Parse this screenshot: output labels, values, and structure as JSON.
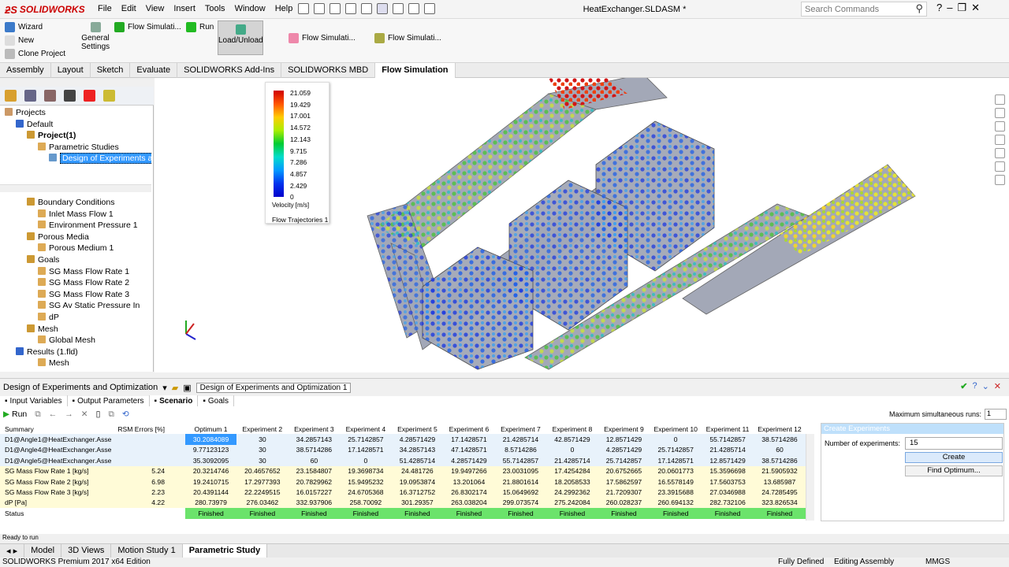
{
  "app": {
    "logo": "SOLIDWORKS",
    "doc_title": "HeatExchanger.SLDASM *",
    "search_placeholder": "Search Commands"
  },
  "menu": [
    "File",
    "Edit",
    "View",
    "Insert",
    "Tools",
    "Window",
    "Help"
  ],
  "ribbon": {
    "wizard": "Wizard",
    "new": "New",
    "clone": "Clone Project",
    "general": "General",
    "settings": "Settings",
    "flow1": "Flow Simulati...",
    "run": "Run",
    "load": "Load/Unload",
    "flow2": "Flow Simulati...",
    "flow3": "Flow Simulati..."
  },
  "tabs": [
    "Assembly",
    "Layout",
    "Sketch",
    "Evaluate",
    "SOLIDWORKS Add-Ins",
    "SOLIDWORKS MBD",
    "Flow Simulation"
  ],
  "tree_top": [
    {
      "label": "Projects",
      "indent": 0
    },
    {
      "label": "Default",
      "indent": 1
    },
    {
      "label": "Project(1)",
      "indent": 2,
      "bold": true
    },
    {
      "label": "Parametric Studies",
      "indent": 3
    },
    {
      "label": "Design of Experiments an",
      "indent": 4,
      "selected": true
    }
  ],
  "tree_bottom": [
    {
      "label": "Boundary Conditions",
      "indent": 2
    },
    {
      "label": "Inlet Mass Flow 1",
      "indent": 3
    },
    {
      "label": "Environment Pressure 1",
      "indent": 3
    },
    {
      "label": "Porous Media",
      "indent": 2
    },
    {
      "label": "Porous Medium 1",
      "indent": 3
    },
    {
      "label": "Goals",
      "indent": 2
    },
    {
      "label": "SG Mass Flow Rate 1",
      "indent": 3
    },
    {
      "label": "SG Mass Flow Rate 2",
      "indent": 3
    },
    {
      "label": "SG Mass Flow Rate 3",
      "indent": 3
    },
    {
      "label": "SG Av Static Pressure In",
      "indent": 3
    },
    {
      "label": "dP",
      "indent": 3
    },
    {
      "label": "Mesh",
      "indent": 2
    },
    {
      "label": "Global Mesh",
      "indent": 3
    },
    {
      "label": "Results (1.fld)",
      "indent": 1
    },
    {
      "label": "Mesh",
      "indent": 3
    }
  ],
  "legend": {
    "values": [
      "21.059",
      "19.429",
      "17.001",
      "14.572",
      "12.143",
      "9.715",
      "7.286",
      "4.857",
      "2.429",
      "0"
    ],
    "unit": "Velocity [m/s]",
    "name": "Flow Trajectories 1"
  },
  "bottom": {
    "study_name": "Design of Experiments and Optimization",
    "study_field": "Design of Experiments and Optimization 1",
    "subtabs": [
      "Input Variables",
      "Output Parameters",
      "Scenario",
      "Goals"
    ],
    "run": "Run",
    "max_label": "Maximum simultaneous runs:",
    "max_value": "1"
  },
  "table": {
    "columns": [
      "Summary",
      "RSM Errors [%]",
      "Optimum 1",
      "Experiment 2",
      "Experiment 3",
      "Experiment 4",
      "Experiment 5",
      "Experiment 6",
      "Experiment 7",
      "Experiment 8",
      "Experiment 9",
      "Experiment 10",
      "Experiment 11",
      "Experiment 12"
    ],
    "rows": [
      {
        "label": "D1@Angle1@HeatExchanger.Asse",
        "rsm": "",
        "cells": [
          "30.2084089",
          "30",
          "34.2857143",
          "25.7142857",
          "4.28571429",
          "17.1428571",
          "21.4285714",
          "42.8571429",
          "12.8571429",
          "0",
          "55.7142857",
          "38.5714286"
        ],
        "kind": "blue"
      },
      {
        "label": "D1@Angle4@HeatExchanger.Asse",
        "rsm": "",
        "cells": [
          "9.77123123",
          "30",
          "38.5714286",
          "17.1428571",
          "34.2857143",
          "47.1428571",
          "8.5714286",
          "0",
          "4.28571429",
          "25.7142857",
          "21.4285714",
          "60"
        ],
        "kind": "blue"
      },
      {
        "label": "D1@Angle5@HeatExchanger.Asse",
        "rsm": "",
        "cells": [
          "35.3092095",
          "30",
          "60",
          "0",
          "51.4285714",
          "4.28571429",
          "55.7142857",
          "21.4285714",
          "25.7142857",
          "17.1428571",
          "12.8571429",
          "38.5714286"
        ],
        "kind": "blue"
      },
      {
        "label": "SG Mass Flow Rate 1 [kg/s]",
        "rsm": "5.24",
        "cells": [
          "20.3214746",
          "20.4657652",
          "23.1584807",
          "19.3698734",
          "24.481726",
          "19.9497266",
          "23.0031095",
          "17.4254284",
          "20.6752665",
          "20.0601773",
          "15.3596698",
          "21.5905932"
        ],
        "kind": "yel"
      },
      {
        "label": "SG Mass Flow Rate 2 [kg/s]",
        "rsm": "6.98",
        "cells": [
          "19.2410715",
          "17.2977393",
          "20.7829962",
          "15.9495232",
          "19.0953874",
          "13.201064",
          "21.8801614",
          "18.2058533",
          "17.5862597",
          "16.5578149",
          "17.5603753",
          "13.685987"
        ],
        "kind": "yel"
      },
      {
        "label": "SG Mass Flow Rate 3 [kg/s]",
        "rsm": "2.23",
        "cells": [
          "20.4391144",
          "22.2249515",
          "16.0157227",
          "24.6705368",
          "16.3712752",
          "26.8302174",
          "15.0649692",
          "24.2992362",
          "21.7209307",
          "23.3915688",
          "27.0346988",
          "24.7285495"
        ],
        "kind": "yel"
      },
      {
        "label": "dP [Pa]",
        "rsm": "4.22",
        "cells": [
          "280.73979",
          "276.03462",
          "332.937906",
          "258.70092",
          "301.29357",
          "263.038204",
          "299.073574",
          "275.242084",
          "260.028237",
          "260.694132",
          "282.732106",
          "323.826534"
        ],
        "kind": "yel"
      },
      {
        "label": "Status",
        "rsm": "",
        "cells": [
          "Finished",
          "Finished",
          "Finished",
          "Finished",
          "Finished",
          "Finished",
          "Finished",
          "Finished",
          "Finished",
          "Finished",
          "Finished",
          "Finished"
        ],
        "kind": "st"
      }
    ]
  },
  "create_panel": {
    "title": "Create Experiments",
    "label": "Number of experiments:",
    "value": "15",
    "create": "Create",
    "find": "Find Optimum..."
  },
  "status_small": "Ready to run",
  "sheet_tabs": [
    "Model",
    "3D Views",
    "Motion Study 1",
    "Parametric Study"
  ],
  "statusbar": {
    "edition": "SOLIDWORKS Premium 2017 x64 Edition",
    "defined": "Fully Defined",
    "editing": "Editing Assembly",
    "units": "MMGS"
  }
}
